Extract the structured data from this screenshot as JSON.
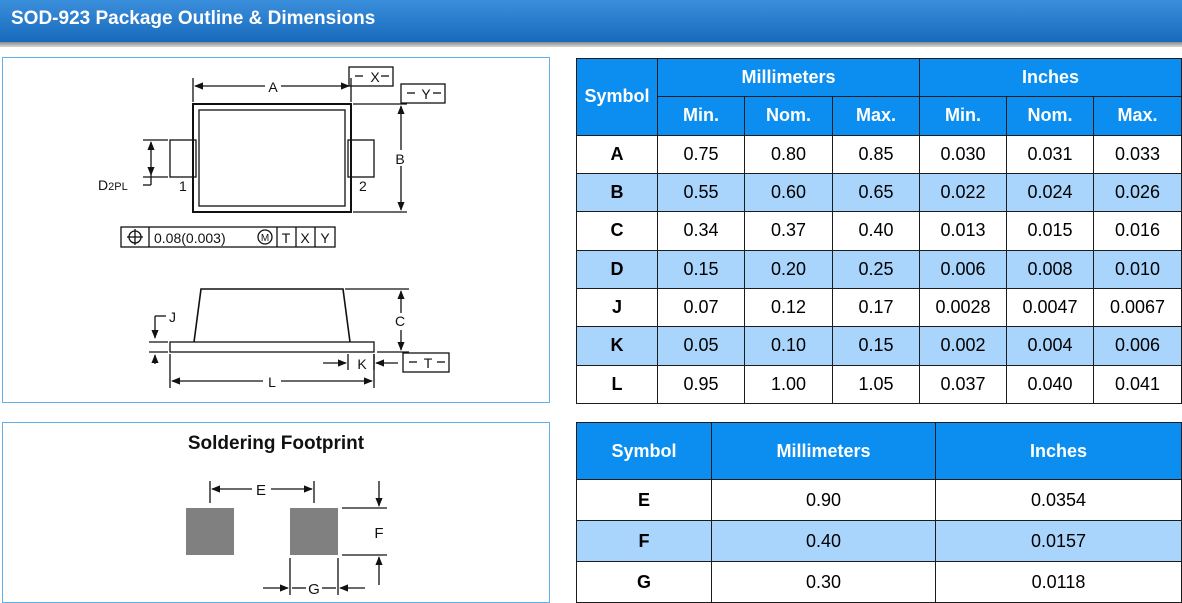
{
  "header": {
    "title": "SOD-923 Package Outline & Dimensions"
  },
  "outline_drawing": {
    "labels": {
      "A": "A",
      "B": "B",
      "C": "C",
      "J": "J",
      "K": "K",
      "L": "L",
      "D": "D",
      "d_suffix": "2PL",
      "pin1": "1",
      "pin2": "2",
      "datum_x": "X",
      "datum_y": "Y",
      "datum_t": "T"
    },
    "tolerance_frame": {
      "value": "0.08(0.003)",
      "modifier": "M",
      "refs": [
        "T",
        "X",
        "Y"
      ]
    }
  },
  "main_table": {
    "symbol_header": "Symbol",
    "group_headers": [
      "Millimeters",
      "Inches"
    ],
    "sub_headers": [
      "Min.",
      "Nom.",
      "Max.",
      "Min.",
      "Nom.",
      "Max."
    ],
    "rows": [
      {
        "symbol": "A",
        "values": [
          "0.75",
          "0.80",
          "0.85",
          "0.030",
          "0.031",
          "0.033"
        ]
      },
      {
        "symbol": "B",
        "values": [
          "0.55",
          "0.60",
          "0.65",
          "0.022",
          "0.024",
          "0.026"
        ]
      },
      {
        "symbol": "C",
        "values": [
          "0.34",
          "0.37",
          "0.40",
          "0.013",
          "0.015",
          "0.016"
        ]
      },
      {
        "symbol": "D",
        "values": [
          "0.15",
          "0.20",
          "0.25",
          "0.006",
          "0.008",
          "0.010"
        ]
      },
      {
        "symbol": "J",
        "values": [
          "0.07",
          "0.12",
          "0.17",
          "0.0028",
          "0.0047",
          "0.0067"
        ]
      },
      {
        "symbol": "K",
        "values": [
          "0.05",
          "0.10",
          "0.15",
          "0.002",
          "0.004",
          "0.006"
        ]
      },
      {
        "symbol": "L",
        "values": [
          "0.95",
          "1.00",
          "1.05",
          "0.037",
          "0.040",
          "0.041"
        ]
      }
    ]
  },
  "footprint": {
    "title": "Soldering Footprint",
    "labels": {
      "E": "E",
      "F": "F",
      "G": "G"
    }
  },
  "footprint_table": {
    "headers": [
      "Symbol",
      "Millimeters",
      "Inches"
    ],
    "rows": [
      {
        "symbol": "E",
        "mm": "0.90",
        "inch": "0.0354"
      },
      {
        "symbol": "F",
        "mm": "0.40",
        "inch": "0.0157"
      },
      {
        "symbol": "G",
        "mm": "0.30",
        "inch": "0.0118"
      }
    ]
  }
}
